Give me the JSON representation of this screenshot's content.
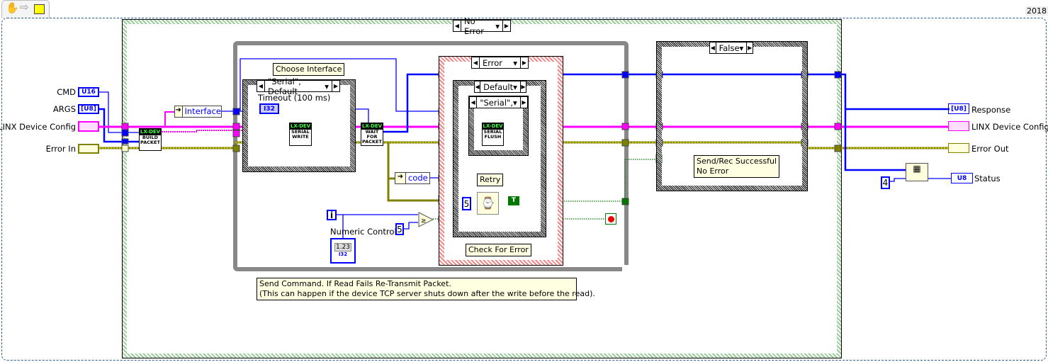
{
  "toolbar": {
    "icons": [
      "hand-icon",
      "run-arrow-icon",
      "vi-icon"
    ],
    "version": "2018"
  },
  "colors": {
    "numeric": "#0000ff",
    "cluster": "#ff00ff",
    "error": "#808000",
    "boolean": "#007000",
    "comment_bg": "#ffffe1"
  },
  "inputs": [
    {
      "label": "CMD",
      "type": "U16"
    },
    {
      "label": "ARGS",
      "type": "[U8]"
    },
    {
      "label": "LINX Device Config",
      "type": "cluster"
    },
    {
      "label": "Error In",
      "type": "error"
    }
  ],
  "outputs": [
    {
      "label": "Response",
      "type": "[U8]"
    },
    {
      "label": "LINX Device Config",
      "type": "cluster"
    },
    {
      "label": "Error Out",
      "type": "error"
    },
    {
      "label": "Status",
      "type": "U8"
    }
  ],
  "outer_case": {
    "selector": "No Error"
  },
  "subvis": {
    "build": {
      "header": "LX-DEV",
      "name": "BUILD PACKET"
    },
    "write": {
      "header": "LX-DEV",
      "name": "SERIAL WRITE"
    },
    "wait": {
      "header": "LX-DEV",
      "name": "WAIT FOR PACKET"
    },
    "flush": {
      "header": "LX-DEV",
      "name": "SERIAL FLUSH"
    }
  },
  "unbundle_interface": "Interface",
  "unbundle_code": "code",
  "choose_interface": {
    "label": "Choose Interface",
    "selector": "\"Serial\", Default",
    "timeout_label": "Timeout (100 ms)",
    "timeout_type": "I32"
  },
  "error_case": {
    "selector": "Error",
    "inner_selector": "Default",
    "serial_selector": "\"Serial\",",
    "retry_label": "Retry",
    "wait_const": "5",
    "bool_const": "T",
    "label": "Check For Error"
  },
  "loop": {
    "iteration": "i",
    "compare_const": "5",
    "numeric_label": "Numeric Control",
    "numeric_value": "1.23",
    "numeric_type": "I32"
  },
  "comment": {
    "line1": "Send Command.  If Read Fails Re-Transmit Packet.",
    "line2": "(This can happen if the device TCP server shuts down after the write before the read)."
  },
  "false_case": {
    "selector": "False",
    "label_line1": "Send/Rec Successful",
    "label_line2": "No Error"
  },
  "index": {
    "const": "4"
  }
}
